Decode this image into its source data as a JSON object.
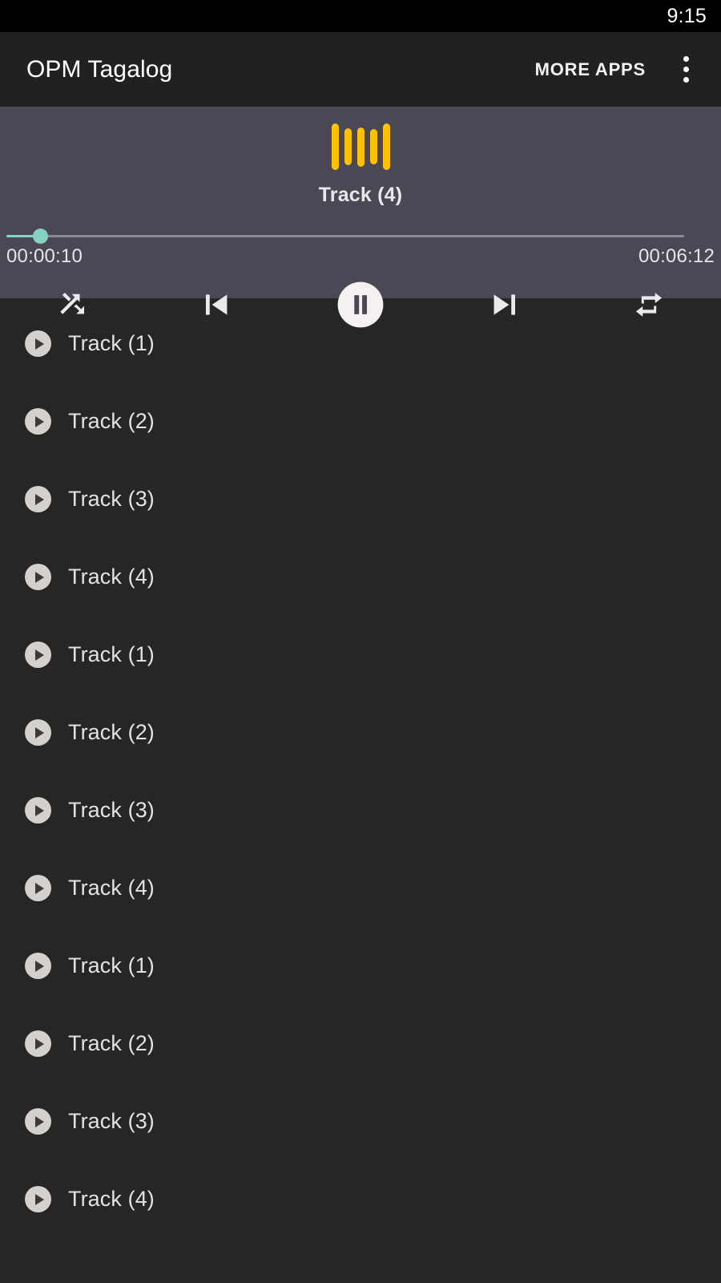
{
  "status_bar": {
    "time": "9:15"
  },
  "app_bar": {
    "title": "OPM Tagalog",
    "more_apps_label": "MORE APPS",
    "overflow_icon": "more-vertical-icon"
  },
  "player": {
    "equalizer_icon": "equalizer-icon",
    "equalizer_color": "#ffc107",
    "now_playing": "Track (4)",
    "elapsed_time": "00:00:10",
    "total_time": "00:06:12",
    "progress_percent": 5,
    "accent_color": "#86d1c2",
    "panel_color": "#4a4854",
    "controls": [
      {
        "name": "shuffle-button",
        "icon": "shuffle-icon",
        "label": "Shuffle"
      },
      {
        "name": "previous-button",
        "icon": "skip-previous-icon",
        "label": "Previous"
      },
      {
        "name": "play-pause-button",
        "icon": "pause-icon",
        "label": "Pause"
      },
      {
        "name": "next-button",
        "icon": "skip-next-icon",
        "label": "Next"
      },
      {
        "name": "repeat-button",
        "icon": "repeat-icon",
        "label": "Repeat"
      }
    ]
  },
  "track_list": {
    "items": [
      {
        "label": "Track (1)",
        "icon": "play-circle-icon"
      },
      {
        "label": "Track (2)",
        "icon": "play-circle-icon"
      },
      {
        "label": "Track (3)",
        "icon": "play-circle-icon"
      },
      {
        "label": "Track (4)",
        "icon": "play-circle-icon"
      },
      {
        "label": "Track (1)",
        "icon": "play-circle-icon"
      },
      {
        "label": "Track (2)",
        "icon": "play-circle-icon"
      },
      {
        "label": "Track (3)",
        "icon": "play-circle-icon"
      },
      {
        "label": "Track (4)",
        "icon": "play-circle-icon"
      },
      {
        "label": "Track (1)",
        "icon": "play-circle-icon"
      },
      {
        "label": "Track (2)",
        "icon": "play-circle-icon"
      },
      {
        "label": "Track (3)",
        "icon": "play-circle-icon"
      },
      {
        "label": "Track (4)",
        "icon": "play-circle-icon"
      }
    ]
  }
}
